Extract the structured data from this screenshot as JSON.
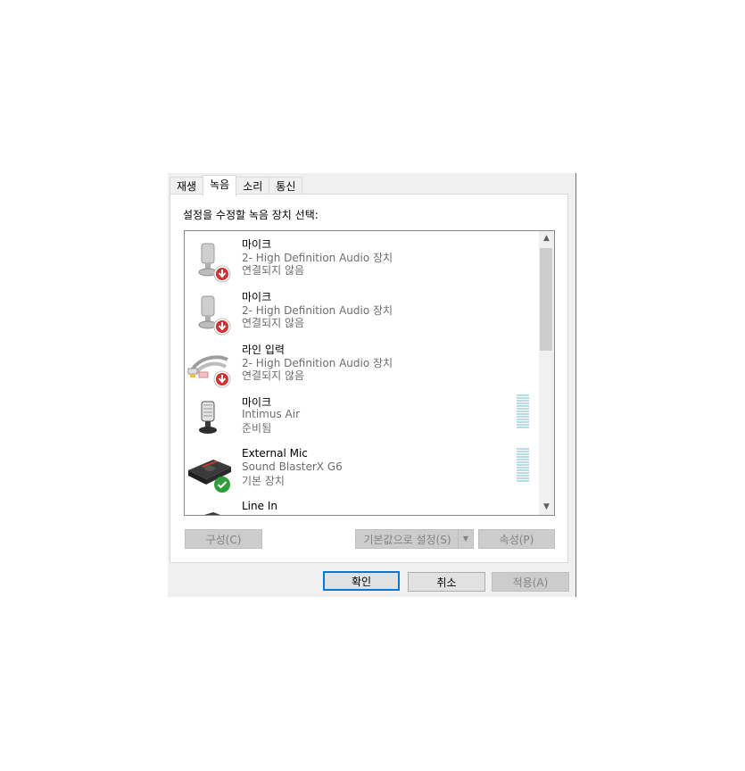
{
  "tabs": [
    {
      "label": "재생"
    },
    {
      "label": "녹음"
    },
    {
      "label": "소리"
    },
    {
      "label": "통신"
    }
  ],
  "prompt": "설정을 수정할 녹음 장치 선택:",
  "devices": [
    {
      "name": "마이크",
      "detail": "2- High Definition Audio 장치",
      "status": "연결되지 않음",
      "icon": "microphone-icon",
      "badge": "disconnected-badge-icon"
    },
    {
      "name": "마이크",
      "detail": "2- High Definition Audio 장치",
      "status": "연결되지 않음",
      "icon": "microphone-icon",
      "badge": "disconnected-badge-icon"
    },
    {
      "name": "라인 입력",
      "detail": "2- High Definition Audio 장치",
      "status": "연결되지 않음",
      "icon": "line-in-cable-icon",
      "badge": "disconnected-badge-icon"
    },
    {
      "name": "마이크",
      "detail": "Intimus Air",
      "status": "준비됨",
      "icon": "microphone-icon"
    },
    {
      "name": "External Mic",
      "detail": "Sound BlasterX G6",
      "status": "기본 장치",
      "icon": "sound-card-icon",
      "badge": "default-check-badge-icon"
    },
    {
      "name": "Line In",
      "detail": "",
      "status": "",
      "icon": "sound-card-icon"
    }
  ],
  "buttons": {
    "configure": "구성(C)",
    "set_default": "기본값으로 설정(S)",
    "properties": "속성(P)",
    "ok": "확인",
    "cancel": "취소",
    "apply": "적용(A)"
  },
  "colors": {
    "accent": "#0078d7",
    "disconnected_badge": "#d32f2f",
    "default_badge": "#2e9d3a",
    "meter": "#b8dce6"
  }
}
